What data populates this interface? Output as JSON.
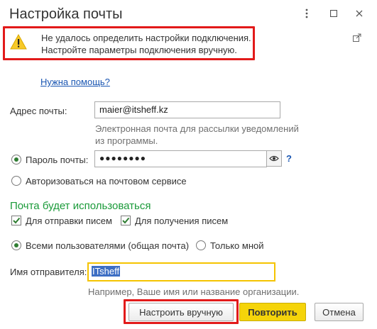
{
  "window": {
    "title": "Настройка почты",
    "menu_icon": "more-vertical-icon",
    "maximize_icon": "maximize-icon",
    "close_icon": "close-icon"
  },
  "warning": {
    "icon": "warning-icon",
    "line1": "Не удалось определить настройки подключения.",
    "line2": "Настройте параметры подключения вручную.",
    "external_icon": "external-link-icon"
  },
  "help_link": "Нужна помощь?",
  "email": {
    "label": "Адрес почты:",
    "value": "maier@itsheff.kz",
    "hint_line1": "Электронная почта для рассылки уведомлений",
    "hint_line2": "из программы."
  },
  "auth": {
    "password_label": "Пароль почты:",
    "password_value": "●●●●●●●●",
    "password_selected": true,
    "eye_icon": "eye-icon",
    "help_mark": "?",
    "oauth_label": "Авторизоваться на почтовом сервисе",
    "oauth_selected": false
  },
  "usage": {
    "title": "Почта будет использоваться",
    "send_label": "Для отправки писем",
    "send_checked": true,
    "receive_label": "Для получения писем",
    "receive_checked": true,
    "all_users_label": "Всеми пользователями (общая почта)",
    "all_users_selected": true,
    "only_me_label": "Только мной",
    "only_me_selected": false
  },
  "sender": {
    "label": "Имя отправителя:",
    "value": "ITsheff",
    "hint": "Например, Ваше имя или название организации."
  },
  "buttons": {
    "manual": "Настроить вручную",
    "retry": "Повторить",
    "cancel": "Отмена"
  },
  "colors": {
    "highlight_red": "#e21a1a",
    "link_blue": "#1a56b2",
    "section_green": "#1a9a39",
    "primary_yellow": "#f5d40a"
  }
}
